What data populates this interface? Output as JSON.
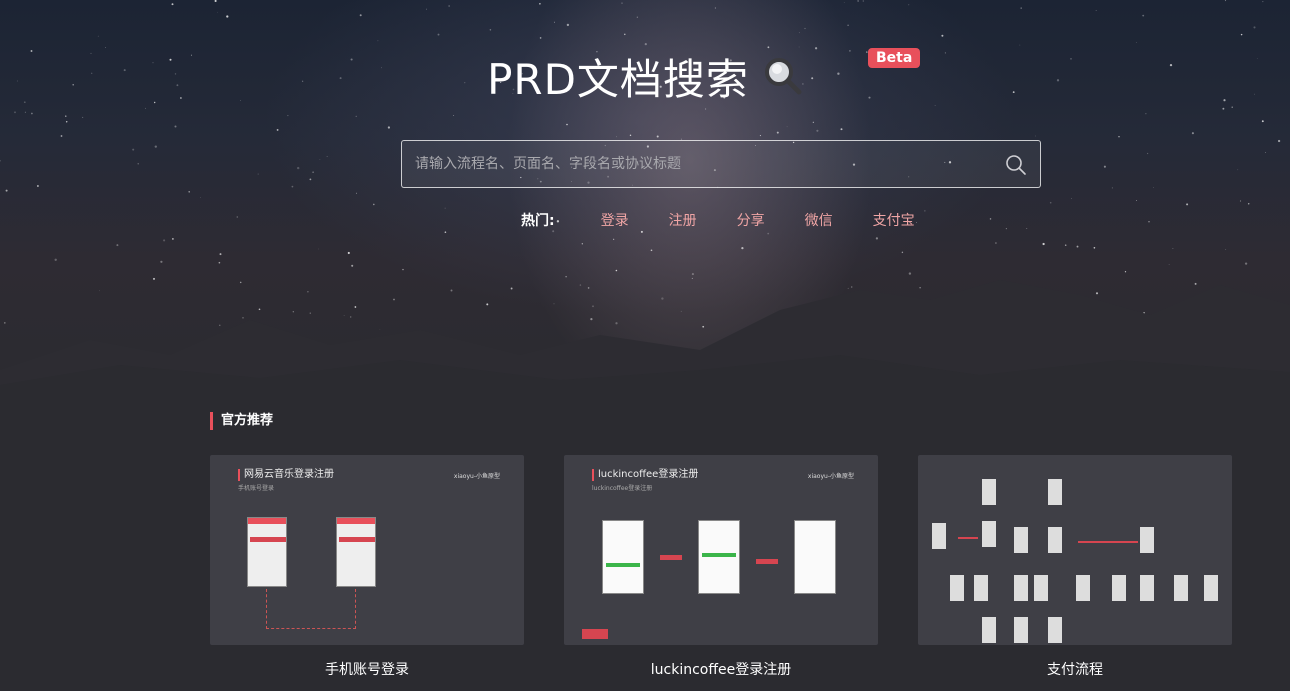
{
  "header": {
    "title": "PRD文档搜索",
    "badge": "Beta"
  },
  "search": {
    "placeholder": "请输入流程名、页面名、字段名或协议标题",
    "value": ""
  },
  "hot": {
    "label": "热门:",
    "links": [
      "登录",
      "注册",
      "分享",
      "微信",
      "支付宝"
    ]
  },
  "section": {
    "title": "官方推荐"
  },
  "cards": [
    {
      "title": "手机账号登录",
      "thumb_title": "网易云音乐登录注册",
      "thumb_sub": "手机账号登录",
      "thumb_brand": "xiaoyu-小鱼原型"
    },
    {
      "title": "luckincoffee登录注册",
      "thumb_title": "luckincoffee登录注册",
      "thumb_sub": "luckincoffee登录注册",
      "thumb_brand": "xiaoyu-小鱼原型"
    },
    {
      "title": "支付流程"
    }
  ],
  "colors": {
    "accent": "#e8505b",
    "hot_link": "#f0a5a5",
    "card_bg": "#3f3f46",
    "page_bg": "#2b2b30"
  },
  "icons": {
    "title_icon": "magnifier-icon",
    "search_button": "search-icon"
  }
}
